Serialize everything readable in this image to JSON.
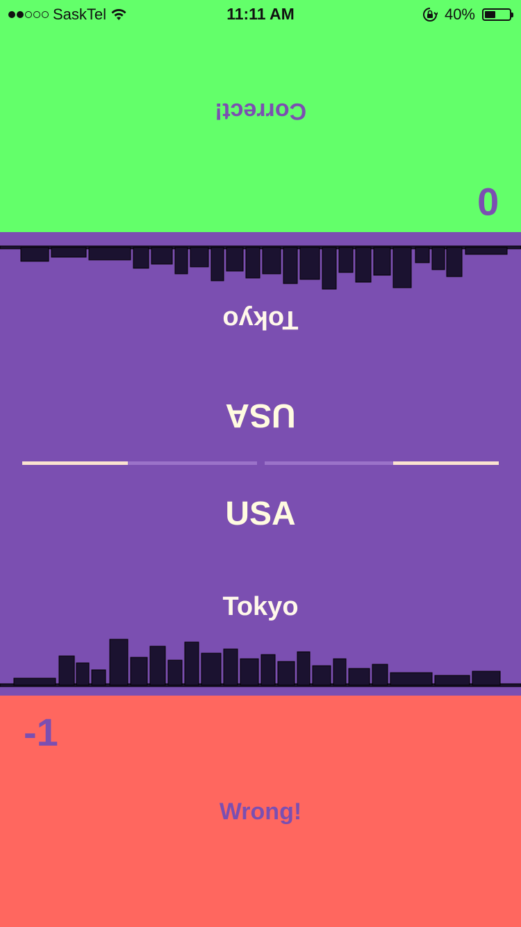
{
  "status_bar": {
    "carrier": "SaskTel",
    "time": "11:11 AM",
    "battery": "40%",
    "signal_bars_filled": 2,
    "signal_bars_total": 5
  },
  "top_player": {
    "result": "Correct!",
    "score": "0",
    "color": "#63ff6a"
  },
  "bottom_player": {
    "result": "Wrong!",
    "score": "-1",
    "color": "#ff675f"
  },
  "card": {
    "country": "USA",
    "city": "Tokyo",
    "background": "#7b4fb1"
  },
  "timers": {
    "top_remaining": 0.45,
    "bottom_remaining": 0.45
  },
  "icons": [
    "wifi-icon",
    "rotation-lock-icon",
    "battery-icon",
    "skyline-icon"
  ]
}
